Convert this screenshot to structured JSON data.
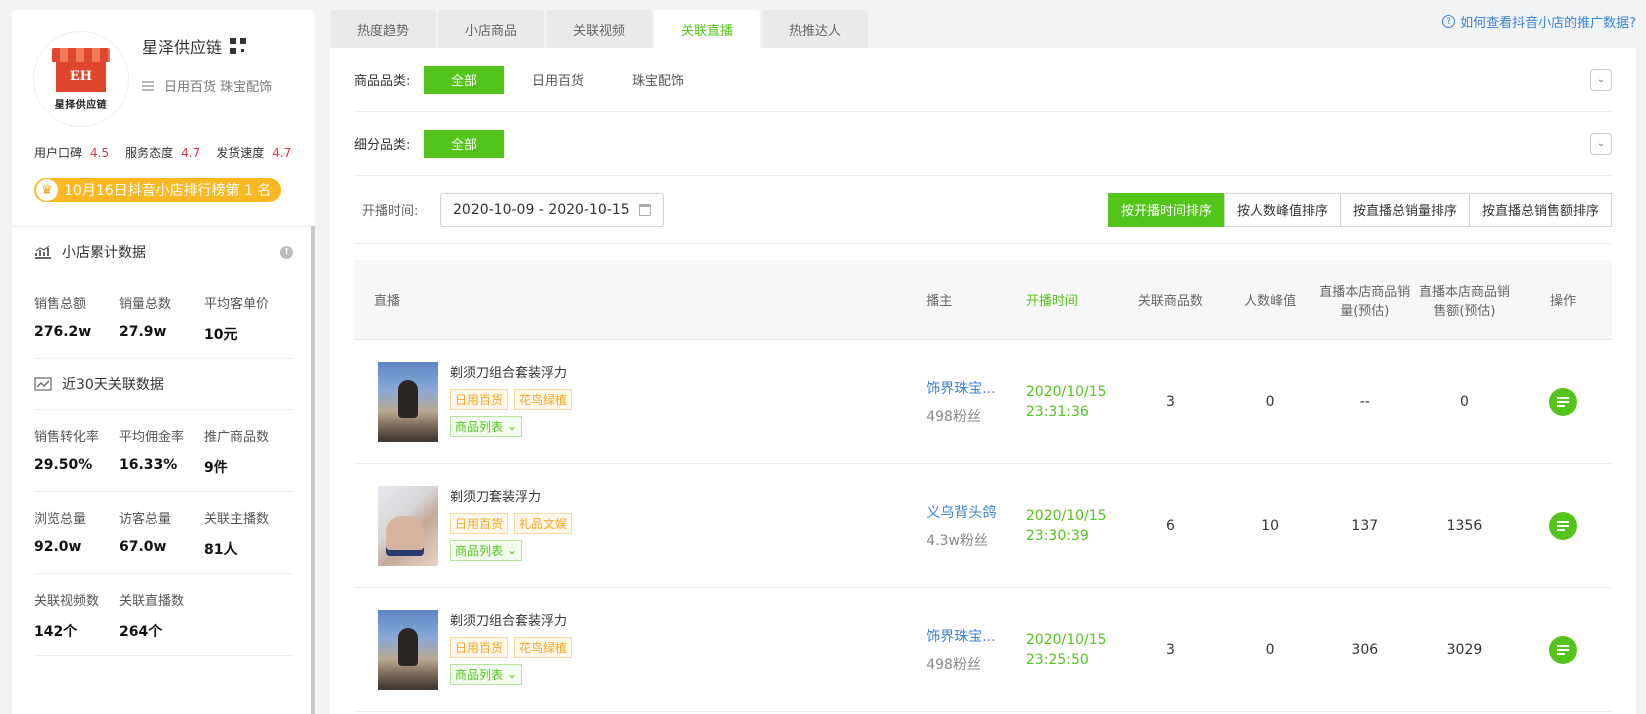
{
  "shop": {
    "name": "星泽供应链",
    "logo_text": "星择供应链",
    "logo_mark": "EH",
    "categories": "日用百货 珠宝配饰",
    "ratings": [
      {
        "label": "用户口碑",
        "score": "4.5"
      },
      {
        "label": "服务态度",
        "score": "4.7"
      },
      {
        "label": "发货速度",
        "score": "4.7"
      }
    ],
    "rank_badge": "10月16日抖音小店排行榜第 1 名"
  },
  "cumulative": {
    "title": "小店累计数据",
    "stats": [
      {
        "label": "销售总额",
        "value": "276.2w"
      },
      {
        "label": "销量总数",
        "value": "27.9w"
      },
      {
        "label": "平均客单价",
        "value": "10元"
      }
    ]
  },
  "recent30": {
    "title": "近30天关联数据",
    "rows": [
      [
        {
          "label": "销售转化率",
          "value": "29.50%"
        },
        {
          "label": "平均佣金率",
          "value": "16.33%"
        },
        {
          "label": "推广商品数",
          "value": "9件"
        }
      ],
      [
        {
          "label": "浏览总量",
          "value": "92.0w"
        },
        {
          "label": "访客总量",
          "value": "67.0w"
        },
        {
          "label": "关联主播数",
          "value": "81人"
        }
      ],
      [
        {
          "label": "关联视频数",
          "value": "142个"
        },
        {
          "label": "关联直播数",
          "value": "264个"
        }
      ]
    ]
  },
  "tabs": [
    "热度趋势",
    "小店商品",
    "关联视频",
    "关联直播",
    "热推达人"
  ],
  "active_tab": 3,
  "help_link": "如何查看抖音小店的推广数据?",
  "filters": {
    "category_label": "商品品类:",
    "category_options": [
      "全部",
      "日用百货",
      "珠宝配饰"
    ],
    "subcategory_label": "细分品类:",
    "subcategory_options": [
      "全部"
    ],
    "date_label": "开播时间:",
    "date_range": "2020-10-09 - 2020-10-15"
  },
  "sort_buttons": [
    "按开播时间排序",
    "按人数峰值排序",
    "按直播总销量排序",
    "按直播总销售额排序"
  ],
  "table": {
    "headers": {
      "live": "直播",
      "host": "播主",
      "time": "开播时间",
      "goods": "关联商品数",
      "peak": "人数峰值",
      "volume": "直播本店商品销量(预估)",
      "amount": "直播本店商品销售额(预估)",
      "op": "操作"
    },
    "goods_list_label": "商品列表",
    "rows": [
      {
        "title": "剃须刀组合套装浮力",
        "tags": [
          "日用百货",
          "花鸟绿植"
        ],
        "host": "饰界珠宝...",
        "fans": "498粉丝",
        "date": "2020/10/15",
        "time": "23:31:36",
        "goods": "3",
        "peak": "0",
        "volume": "--",
        "amount": "0"
      },
      {
        "title": "剃须刀套装浮力",
        "tags": [
          "日用百货",
          "礼品文娱"
        ],
        "host": "义乌背头鸽",
        "fans": "4.3w粉丝",
        "date": "2020/10/15",
        "time": "23:30:39",
        "goods": "6",
        "peak": "10",
        "volume": "137",
        "amount": "1356"
      },
      {
        "title": "剃须刀组合套装浮力",
        "tags": [
          "日用百货",
          "花鸟绿植"
        ],
        "host": "饰界珠宝...",
        "fans": "498粉丝",
        "date": "2020/10/15",
        "time": "23:25:50",
        "goods": "3",
        "peak": "0",
        "volume": "306",
        "amount": "3029"
      }
    ]
  },
  "colors": {
    "accent": "#52c41a",
    "link": "#3b83d6",
    "score": "#e3344c",
    "badge": "#fbb822",
    "tag": "#f5a623"
  }
}
